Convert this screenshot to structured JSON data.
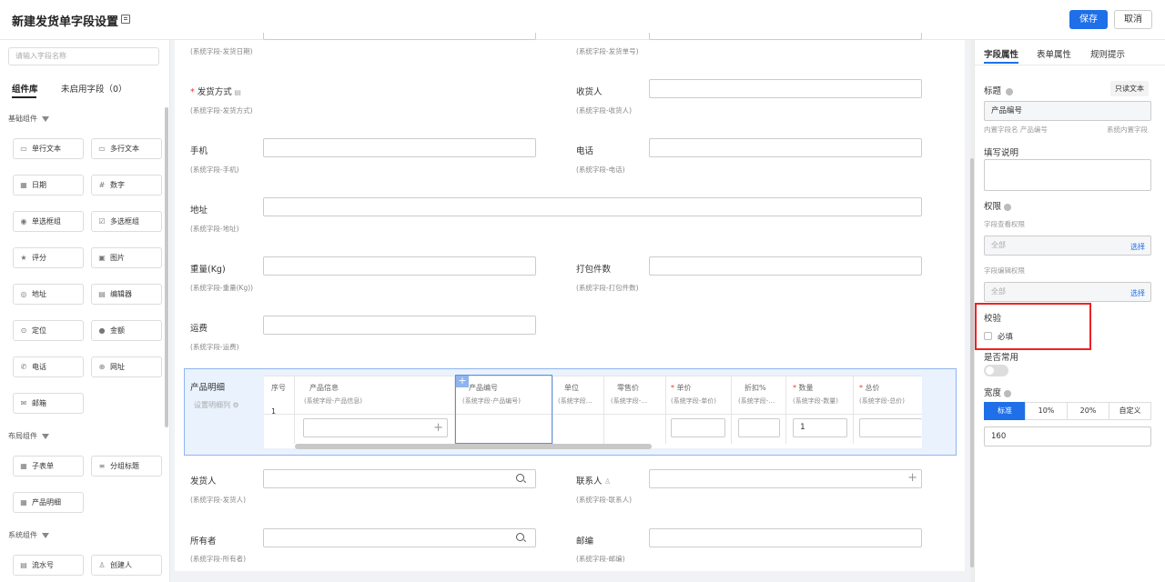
{
  "header": {
    "title": "新建发货单字段设置",
    "save": "保存",
    "cancel": "取消"
  },
  "left": {
    "search_placeholder": "请输入字段名称",
    "tabs": [
      "组件库",
      "未启用字段（0）"
    ],
    "sections": [
      "基础组件",
      "布局组件",
      "系统组件"
    ],
    "basic": [
      "单行文本",
      "多行文本",
      "日期",
      "数字",
      "单选框组",
      "多选框组",
      "评分",
      "图片",
      "地址",
      "编辑器",
      "定位",
      "金额",
      "电话",
      "网址",
      "邮箱"
    ],
    "layout": [
      "子表单",
      "分组标题",
      "产品明细"
    ],
    "system": [
      "流水号",
      "创建人"
    ]
  },
  "form": {
    "top_left_sub": "(系统字段-发货日期)",
    "top_right_sub": "(系统字段-发货单号)",
    "ship_method": {
      "label": "发货方式",
      "sub": "(系统字段-发货方式)"
    },
    "receiver": {
      "label": "收货人",
      "sub": "(系统字段-收货人)"
    },
    "mobile": {
      "label": "手机",
      "sub": "(系统字段-手机)"
    },
    "phone": {
      "label": "电话",
      "sub": "(系统字段-电话)"
    },
    "address": {
      "label": "地址",
      "sub": "(系统字段-地址)"
    },
    "weight": {
      "label": "重量(Kg)",
      "sub": "(系统字段-重量(Kg))"
    },
    "packages": {
      "label": "打包件数",
      "sub": "(系统字段-打包件数)"
    },
    "freight": {
      "label": "运费",
      "sub": "(系统字段-运费)"
    },
    "detail": {
      "label": "产品明细",
      "set_cols": "设置明细列",
      "columns": [
        {
          "h": "序号",
          "s": ""
        },
        {
          "h": "产品信息",
          "s": "(系统字段-产品信息)"
        },
        {
          "h": "产品编号",
          "s": "(系统字段-产品编号)"
        },
        {
          "h": "单位",
          "s": "(系统字段…"
        },
        {
          "h": "零售价",
          "s": "(系统字段-…"
        },
        {
          "h": "单价",
          "s": "(系统字段-单价)"
        },
        {
          "h": "折扣%",
          "s": "(系统字段-…"
        },
        {
          "h": "数量",
          "s": "(系统字段-数量)"
        },
        {
          "h": "总价",
          "s": "(系统字段-总价)"
        }
      ],
      "row_no": "1",
      "qty_value": "1"
    },
    "shipper": {
      "label": "发货人",
      "sub": "(系统字段-发货人)"
    },
    "contact": {
      "label": "联系人",
      "sub": "(系统字段-联系人)"
    },
    "owner": {
      "label": "所有者",
      "sub": "(系统字段-所有者)"
    },
    "zip": {
      "label": "邮编",
      "sub": "(系统字段-邮编)"
    }
  },
  "right": {
    "tabs": [
      "字段属性",
      "表单属性",
      "规则提示"
    ],
    "title_label": "标题",
    "readonly": "只读文本",
    "title_value": "产品编号",
    "builtin_name": "内置字段名 产品编号",
    "builtin_type": "系统内置字段",
    "desc_label": "填写说明",
    "perm_label": "权限",
    "view_perm": "字段查看权限",
    "edit_perm": "字段编辑权限",
    "all": "全部",
    "choose": "选择",
    "validate": "校验",
    "required": "必填",
    "common": "是否常用",
    "width_label": "宽度",
    "width_opts": [
      "标准",
      "10%",
      "20%",
      "自定义"
    ],
    "width_value": "160"
  }
}
